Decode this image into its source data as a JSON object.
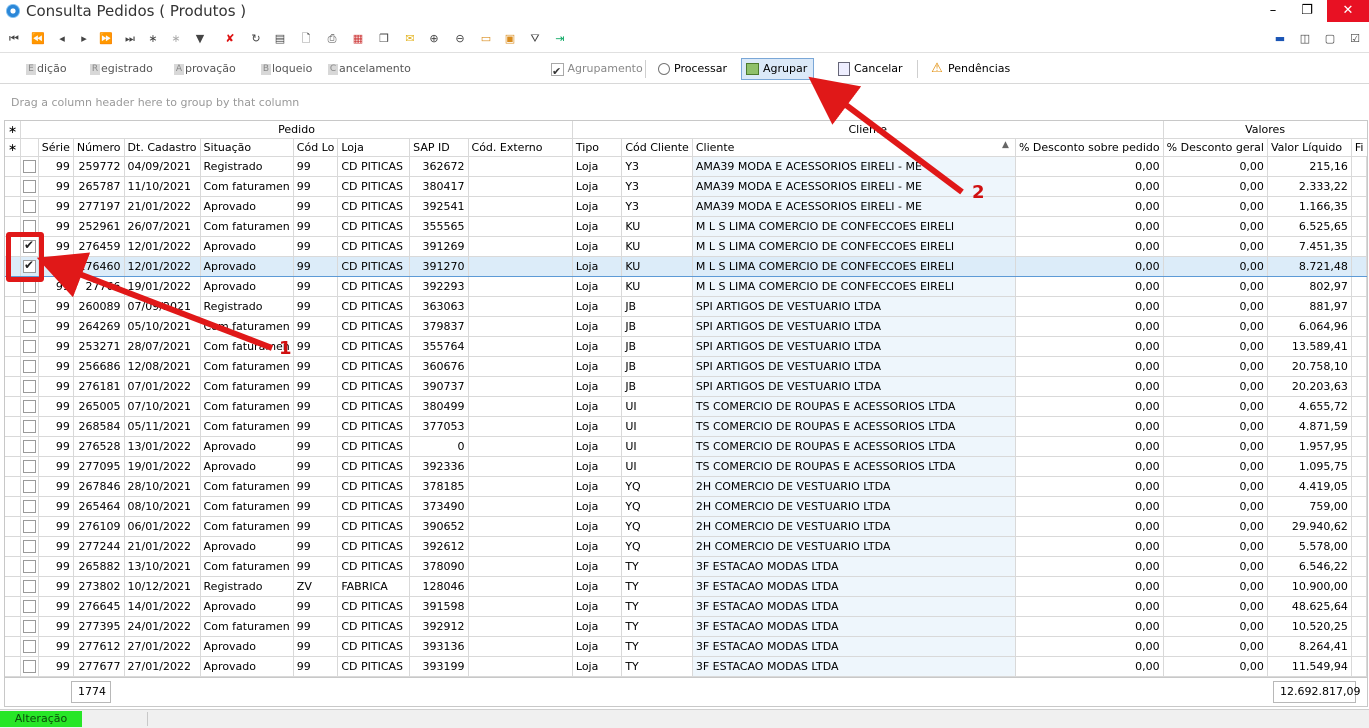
{
  "window": {
    "title": "Consulta Pedidos ( Produtos )",
    "minimize": "–",
    "restore": "❐",
    "close": "✕"
  },
  "mode_tabs": [
    {
      "key": "E",
      "rest": "dição"
    },
    {
      "key": "R",
      "rest": "egistrado"
    },
    {
      "key": "A",
      "rest": "provação"
    },
    {
      "key": "B",
      "rest": "loqueio"
    },
    {
      "key": "C",
      "rest": "ancelamento"
    }
  ],
  "actions": {
    "agrupamento": "Agrupamento",
    "processar": "Processar",
    "agrupar": "Agrupar",
    "cancelar": "Cancelar",
    "pendencias": "Pendências"
  },
  "group_hint": "Drag a column header here to group by that column",
  "bands": {
    "pedido": "Pedido",
    "cliente": "Cliente",
    "valores": "Valores"
  },
  "columns": {
    "serie": "Série",
    "numero": "Número",
    "dt": "Dt. Cadastro",
    "situacao": "Situação",
    "codloja": "Cód Lo",
    "loja": "Loja",
    "sapid": "SAP ID",
    "codext": "Cód. Externo",
    "tipo": "Tipo",
    "codcli": "Cód Cliente",
    "cliente": "Cliente",
    "descped": "% Desconto sobre pedido",
    "descger": "% Desconto geral",
    "valor": "Valor Líquido",
    "extra": "Fi"
  },
  "rows": [
    {
      "checked": false,
      "serie": "99",
      "numero": "259772",
      "dt": "04/09/2021",
      "situacao": "Registrado",
      "codloja": "99",
      "loja": "CD PITICAS",
      "sapid": "362672",
      "tipo": "Loja",
      "codcli": "Y3",
      "cliente": "AMA39 MODA E ACESSORIOS EIRELI - ME",
      "d1": "0,00",
      "d2": "0,00",
      "valor": "215,16"
    },
    {
      "checked": false,
      "serie": "99",
      "numero": "265787",
      "dt": "11/10/2021",
      "situacao": "Com faturamen",
      "codloja": "99",
      "loja": "CD PITICAS",
      "sapid": "380417",
      "tipo": "Loja",
      "codcli": "Y3",
      "cliente": "AMA39 MODA E ACESSORIOS EIRELI - ME",
      "d1": "0,00",
      "d2": "0,00",
      "valor": "2.333,22"
    },
    {
      "checked": false,
      "serie": "99",
      "numero": "277197",
      "dt": "21/01/2022",
      "situacao": "Aprovado",
      "codloja": "99",
      "loja": "CD PITICAS",
      "sapid": "392541",
      "tipo": "Loja",
      "codcli": "Y3",
      "cliente": "AMA39 MODA E ACESSORIOS EIRELI - ME",
      "d1": "0,00",
      "d2": "0,00",
      "valor": "1.166,35"
    },
    {
      "checked": false,
      "serie": "99",
      "numero": "252961",
      "dt": "26/07/2021",
      "situacao": "Com faturamen",
      "codloja": "99",
      "loja": "CD PITICAS",
      "sapid": "355565",
      "tipo": "Loja",
      "codcli": "KU",
      "cliente": "M L S LIMA COMERCIO DE CONFECCOES EIRELI",
      "d1": "0,00",
      "d2": "0,00",
      "valor": "6.525,65"
    },
    {
      "checked": true,
      "serie": "99",
      "numero": "276459",
      "dt": "12/01/2022",
      "situacao": "Aprovado",
      "codloja": "99",
      "loja": "CD PITICAS",
      "sapid": "391269",
      "tipo": "Loja",
      "codcli": "KU",
      "cliente": "M L S LIMA COMERCIO DE CONFECCOES EIRELI",
      "d1": "0,00",
      "d2": "0,00",
      "valor": "7.451,35"
    },
    {
      "checked": true,
      "selected": true,
      "serie": "99",
      "numero": "276460",
      "dt": "12/01/2022",
      "situacao": "Aprovado",
      "codloja": "99",
      "loja": "CD PITICAS",
      "sapid": "391270",
      "tipo": "Loja",
      "codcli": "KU",
      "cliente": "M L S LIMA COMERCIO DE CONFECCOES EIRELI",
      "d1": "0,00",
      "d2": "0,00",
      "valor": "8.721,48"
    },
    {
      "checked": false,
      "serie": "99",
      "numero": "27766",
      "dt": "19/01/2022",
      "situacao": "Aprovado",
      "codloja": "99",
      "loja": "CD PITICAS",
      "sapid": "392293",
      "tipo": "Loja",
      "codcli": "KU",
      "cliente": "M L S LIMA COMERCIO DE CONFECCOES EIRELI",
      "d1": "0,00",
      "d2": "0,00",
      "valor": "802,97"
    },
    {
      "checked": false,
      "serie": "99",
      "numero": "260089",
      "dt": "07/09/2021",
      "situacao": "Registrado",
      "codloja": "99",
      "loja": "CD PITICAS",
      "sapid": "363063",
      "tipo": "Loja",
      "codcli": "JB",
      "cliente": "SPI ARTIGOS DE VESTUARIO LTDA",
      "d1": "0,00",
      "d2": "0,00",
      "valor": "881,97"
    },
    {
      "checked": false,
      "serie": "99",
      "numero": "264269",
      "dt": "05/10/2021",
      "situacao": "Com faturamen",
      "codloja": "99",
      "loja": "CD PITICAS",
      "sapid": "379837",
      "tipo": "Loja",
      "codcli": "JB",
      "cliente": "SPI ARTIGOS DE VESTUARIO LTDA",
      "d1": "0,00",
      "d2": "0,00",
      "valor": "6.064,96"
    },
    {
      "checked": false,
      "serie": "99",
      "numero": "253271",
      "dt": "28/07/2021",
      "situacao": "Com faturamen",
      "codloja": "99",
      "loja": "CD PITICAS",
      "sapid": "355764",
      "tipo": "Loja",
      "codcli": "JB",
      "cliente": "SPI ARTIGOS DE VESTUARIO LTDA",
      "d1": "0,00",
      "d2": "0,00",
      "valor": "13.589,41"
    },
    {
      "checked": false,
      "serie": "99",
      "numero": "256686",
      "dt": "12/08/2021",
      "situacao": "Com faturamen",
      "codloja": "99",
      "loja": "CD PITICAS",
      "sapid": "360676",
      "tipo": "Loja",
      "codcli": "JB",
      "cliente": "SPI ARTIGOS DE VESTUARIO LTDA",
      "d1": "0,00",
      "d2": "0,00",
      "valor": "20.758,10"
    },
    {
      "checked": false,
      "serie": "99",
      "numero": "276181",
      "dt": "07/01/2022",
      "situacao": "Com faturamen",
      "codloja": "99",
      "loja": "CD PITICAS",
      "sapid": "390737",
      "tipo": "Loja",
      "codcli": "JB",
      "cliente": "SPI ARTIGOS DE VESTUARIO LTDA",
      "d1": "0,00",
      "d2": "0,00",
      "valor": "20.203,63"
    },
    {
      "checked": false,
      "serie": "99",
      "numero": "265005",
      "dt": "07/10/2021",
      "situacao": "Com faturamen",
      "codloja": "99",
      "loja": "CD PITICAS",
      "sapid": "380499",
      "tipo": "Loja",
      "codcli": "UI",
      "cliente": "TS COMERCIO DE ROUPAS E ACESSORIOS LTDA",
      "d1": "0,00",
      "d2": "0,00",
      "valor": "4.655,72"
    },
    {
      "checked": false,
      "serie": "99",
      "numero": "268584",
      "dt": "05/11/2021",
      "situacao": "Com faturamen",
      "codloja": "99",
      "loja": "CD PITICAS",
      "sapid": "377053",
      "tipo": "Loja",
      "codcli": "UI",
      "cliente": "TS COMERCIO DE ROUPAS E ACESSORIOS LTDA",
      "d1": "0,00",
      "d2": "0,00",
      "valor": "4.871,59"
    },
    {
      "checked": false,
      "serie": "99",
      "numero": "276528",
      "dt": "13/01/2022",
      "situacao": "Aprovado",
      "codloja": "99",
      "loja": "CD PITICAS",
      "sapid": "0",
      "tipo": "Loja",
      "codcli": "UI",
      "cliente": "TS COMERCIO DE ROUPAS E ACESSORIOS LTDA",
      "d1": "0,00",
      "d2": "0,00",
      "valor": "1.957,95"
    },
    {
      "checked": false,
      "serie": "99",
      "numero": "277095",
      "dt": "19/01/2022",
      "situacao": "Aprovado",
      "codloja": "99",
      "loja": "CD PITICAS",
      "sapid": "392336",
      "tipo": "Loja",
      "codcli": "UI",
      "cliente": "TS COMERCIO DE ROUPAS E ACESSORIOS LTDA",
      "d1": "0,00",
      "d2": "0,00",
      "valor": "1.095,75"
    },
    {
      "checked": false,
      "serie": "99",
      "numero": "267846",
      "dt": "28/10/2021",
      "situacao": "Com faturamen",
      "codloja": "99",
      "loja": "CD PITICAS",
      "sapid": "378185",
      "tipo": "Loja",
      "codcli": "YQ",
      "cliente": "2H COMERCIO DE VESTUARIO LTDA",
      "d1": "0,00",
      "d2": "0,00",
      "valor": "4.419,05"
    },
    {
      "checked": false,
      "serie": "99",
      "numero": "265464",
      "dt": "08/10/2021",
      "situacao": "Com faturamen",
      "codloja": "99",
      "loja": "CD PITICAS",
      "sapid": "373490",
      "tipo": "Loja",
      "codcli": "YQ",
      "cliente": "2H COMERCIO DE VESTUARIO LTDA",
      "d1": "0,00",
      "d2": "0,00",
      "valor": "759,00"
    },
    {
      "checked": false,
      "serie": "99",
      "numero": "276109",
      "dt": "06/01/2022",
      "situacao": "Com faturamen",
      "codloja": "99",
      "loja": "CD PITICAS",
      "sapid": "390652",
      "tipo": "Loja",
      "codcli": "YQ",
      "cliente": "2H COMERCIO DE VESTUARIO LTDA",
      "d1": "0,00",
      "d2": "0,00",
      "valor": "29.940,62"
    },
    {
      "checked": false,
      "serie": "99",
      "numero": "277244",
      "dt": "21/01/2022",
      "situacao": "Aprovado",
      "codloja": "99",
      "loja": "CD PITICAS",
      "sapid": "392612",
      "tipo": "Loja",
      "codcli": "YQ",
      "cliente": "2H COMERCIO DE VESTUARIO LTDA",
      "d1": "0,00",
      "d2": "0,00",
      "valor": "5.578,00"
    },
    {
      "checked": false,
      "serie": "99",
      "numero": "265882",
      "dt": "13/10/2021",
      "situacao": "Com faturamen",
      "codloja": "99",
      "loja": "CD PITICAS",
      "sapid": "378090",
      "tipo": "Loja",
      "codcli": "TY",
      "cliente": "3F ESTACAO MODAS LTDA",
      "d1": "0,00",
      "d2": "0,00",
      "valor": "6.546,22"
    },
    {
      "checked": false,
      "serie": "99",
      "numero": "273802",
      "dt": "10/12/2021",
      "situacao": "Registrado",
      "codloja": "ZV",
      "loja": "FABRICA",
      "sapid": "128046",
      "tipo": "Loja",
      "codcli": "TY",
      "cliente": "3F ESTACAO MODAS LTDA",
      "d1": "0,00",
      "d2": "0,00",
      "valor": "10.900,00"
    },
    {
      "checked": false,
      "serie": "99",
      "numero": "276645",
      "dt": "14/01/2022",
      "situacao": "Aprovado",
      "codloja": "99",
      "loja": "CD PITICAS",
      "sapid": "391598",
      "tipo": "Loja",
      "codcli": "TY",
      "cliente": "3F ESTACAO MODAS LTDA",
      "d1": "0,00",
      "d2": "0,00",
      "valor": "48.625,64"
    },
    {
      "checked": false,
      "serie": "99",
      "numero": "277395",
      "dt": "24/01/2022",
      "situacao": "Com faturamen",
      "codloja": "99",
      "loja": "CD PITICAS",
      "sapid": "392912",
      "tipo": "Loja",
      "codcli": "TY",
      "cliente": "3F ESTACAO MODAS LTDA",
      "d1": "0,00",
      "d2": "0,00",
      "valor": "10.520,25"
    },
    {
      "checked": false,
      "serie": "99",
      "numero": "277612",
      "dt": "27/01/2022",
      "situacao": "Aprovado",
      "codloja": "99",
      "loja": "CD PITICAS",
      "sapid": "393136",
      "tipo": "Loja",
      "codcli": "TY",
      "cliente": "3F ESTACAO MODAS LTDA",
      "d1": "0,00",
      "d2": "0,00",
      "valor": "8.264,41"
    },
    {
      "checked": false,
      "serie": "99",
      "numero": "277677",
      "dt": "27/01/2022",
      "situacao": "Aprovado",
      "codloja": "99",
      "loja": "CD PITICAS",
      "sapid": "393199",
      "tipo": "Loja",
      "codcli": "TY",
      "cliente": "3F ESTACAO MODAS LTDA",
      "d1": "0,00",
      "d2": "0,00",
      "valor": "11.549,94"
    }
  ],
  "footer": {
    "count": "1774",
    "total": "12.692.817,09"
  },
  "status": {
    "mode": "Alteração"
  },
  "annotations": {
    "one": "1",
    "two": "2"
  },
  "colors": {
    "accent_red": "#e01818",
    "status_green": "#27e627",
    "selection": "#dcecf9"
  }
}
